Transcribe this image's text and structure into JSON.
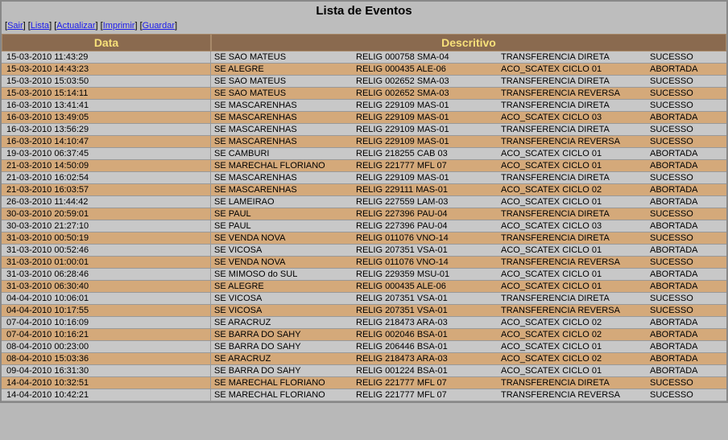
{
  "title": "Lista de Eventos",
  "toolbar": {
    "sair": "Sair",
    "lista": "Lista",
    "actualizar": "Actualizar",
    "imprimir": "Imprimir",
    "guardar": "Guardar"
  },
  "headers": {
    "data": "Data",
    "descritivo": "Descritivo"
  },
  "rows": [
    {
      "data": "15-03-2010 11:43:29",
      "loc": "SE SAO MATEUS",
      "code": "RELIG 000758 SMA-04",
      "evt": "TRANSFERENCIA DIRETA",
      "res": "SUCESSO"
    },
    {
      "data": "15-03-2010 14:43:23",
      "loc": "SE ALEGRE",
      "code": "RELIG 000435 ALE-06",
      "evt": "ACO_SCATEX CICLO 01",
      "res": "ABORTADA"
    },
    {
      "data": "15-03-2010 15:03:50",
      "loc": "SE SAO MATEUS",
      "code": "RELIG 002652 SMA-03",
      "evt": "TRANSFERENCIA DIRETA",
      "res": "SUCESSO"
    },
    {
      "data": "15-03-2010 15:14:11",
      "loc": "SE SAO MATEUS",
      "code": "RELIG 002652 SMA-03",
      "evt": "TRANSFERENCIA REVERSA",
      "res": "SUCESSO"
    },
    {
      "data": "16-03-2010 13:41:41",
      "loc": "SE MASCARENHAS",
      "code": "RELIG 229109 MAS-01",
      "evt": "TRANSFERENCIA DIRETA",
      "res": "SUCESSO"
    },
    {
      "data": "16-03-2010 13:49:05",
      "loc": "SE MASCARENHAS",
      "code": "RELIG 229109 MAS-01",
      "evt": "ACO_SCATEX CICLO 03",
      "res": "ABORTADA"
    },
    {
      "data": "16-03-2010 13:56:29",
      "loc": "SE MASCARENHAS",
      "code": "RELIG 229109 MAS-01",
      "evt": "TRANSFERENCIA DIRETA",
      "res": "SUCESSO"
    },
    {
      "data": "16-03-2010 14:10:47",
      "loc": "SE MASCARENHAS",
      "code": "RELIG 229109 MAS-01",
      "evt": "TRANSFERENCIA REVERSA",
      "res": "SUCESSO"
    },
    {
      "data": "19-03-2010 06:37:45",
      "loc": "SE CAMBURI",
      "code": "RELIG 218255 CAB 03",
      "evt": "ACO_SCATEX CICLO 01",
      "res": "ABORTADA"
    },
    {
      "data": "21-03-2010 14:50:09",
      "loc": "SE MARECHAL FLORIANO",
      "code": "RELIG 221777 MFL 07",
      "evt": "ACO_SCATEX CICLO 01",
      "res": "ABORTADA"
    },
    {
      "data": "21-03-2010 16:02:54",
      "loc": "SE MASCARENHAS",
      "code": "RELIG 229109 MAS-01",
      "evt": "TRANSFERENCIA DIRETA",
      "res": "SUCESSO"
    },
    {
      "data": "21-03-2010 16:03:57",
      "loc": "SE MASCARENHAS",
      "code": "RELIG 229111 MAS-01",
      "evt": "ACO_SCATEX CICLO 02",
      "res": "ABORTADA"
    },
    {
      "data": "26-03-2010 11:44:42",
      "loc": "SE LAMEIRAO",
      "code": "RELIG 227559 LAM-03",
      "evt": "ACO_SCATEX CICLO 01",
      "res": "ABORTADA"
    },
    {
      "data": "30-03-2010 20:59:01",
      "loc": "SE PAUL",
      "code": "RELIG 227396 PAU-04",
      "evt": "TRANSFERENCIA DIRETA",
      "res": "SUCESSO"
    },
    {
      "data": "30-03-2010 21:27:10",
      "loc": "SE PAUL",
      "code": "RELIG 227396 PAU-04",
      "evt": "ACO_SCATEX CICLO 03",
      "res": "ABORTADA"
    },
    {
      "data": "31-03-2010 00:50:19",
      "loc": "SE VENDA NOVA",
      "code": "RELIG 011076 VNO-14",
      "evt": "TRANSFERENCIA DIRETA",
      "res": "SUCESSO"
    },
    {
      "data": "31-03-2010 00:52:46",
      "loc": "SE VICOSA",
      "code": "RELIG 207351 VSA-01",
      "evt": "ACO_SCATEX CICLO 01",
      "res": "ABORTADA"
    },
    {
      "data": "31-03-2010 01:00:01",
      "loc": "SE VENDA NOVA",
      "code": "RELIG 011076 VNO-14",
      "evt": "TRANSFERENCIA REVERSA",
      "res": "SUCESSO"
    },
    {
      "data": "31-03-2010 06:28:46",
      "loc": "SE MIMOSO do SUL",
      "code": "RELIG 229359 MSU-01",
      "evt": "ACO_SCATEX CICLO 01",
      "res": "ABORTADA"
    },
    {
      "data": "31-03-2010 06:30:40",
      "loc": "SE ALEGRE",
      "code": "RELIG 000435 ALE-06",
      "evt": "ACO_SCATEX CICLO 01",
      "res": "ABORTADA"
    },
    {
      "data": "04-04-2010 10:06:01",
      "loc": "SE VICOSA",
      "code": "RELIG 207351 VSA-01",
      "evt": "TRANSFERENCIA DIRETA",
      "res": "SUCESSO"
    },
    {
      "data": "04-04-2010 10:17:55",
      "loc": "SE VICOSA",
      "code": "RELIG 207351 VSA-01",
      "evt": "TRANSFERENCIA REVERSA",
      "res": "SUCESSO"
    },
    {
      "data": "07-04-2010 10:16:09",
      "loc": "SE ARACRUZ",
      "code": "RELIG 218473 ARA-03",
      "evt": "ACO_SCATEX CICLO 02",
      "res": "ABORTADA"
    },
    {
      "data": "07-04-2010 10:16:21",
      "loc": "SE BARRA DO SAHY",
      "code": "RELIG 002046 BSA-01",
      "evt": "ACO_SCATEX CICLO 02",
      "res": "ABORTADA"
    },
    {
      "data": "08-04-2010 00:23:00",
      "loc": "SE BARRA DO SAHY",
      "code": "RELIG 206446 BSA-01",
      "evt": "ACO_SCATEX CICLO 01",
      "res": "ABORTADA"
    },
    {
      "data": "08-04-2010 15:03:36",
      "loc": "SE ARACRUZ",
      "code": "RELIG 218473 ARA-03",
      "evt": "ACO_SCATEX CICLO 02",
      "res": "ABORTADA"
    },
    {
      "data": "09-04-2010 16:31:30",
      "loc": "SE BARRA DO SAHY",
      "code": "RELIG 001224 BSA-01",
      "evt": "ACO_SCATEX CICLO 01",
      "res": "ABORTADA"
    },
    {
      "data": "14-04-2010 10:32:51",
      "loc": "SE MARECHAL FLORIANO",
      "code": "RELIG 221777 MFL 07",
      "evt": "TRANSFERENCIA DIRETA",
      "res": "SUCESSO"
    },
    {
      "data": "14-04-2010 10:42:21",
      "loc": "SE MARECHAL FLORIANO",
      "code": "RELIG 221777 MFL 07",
      "evt": "TRANSFERENCIA REVERSA",
      "res": "SUCESSO"
    }
  ]
}
